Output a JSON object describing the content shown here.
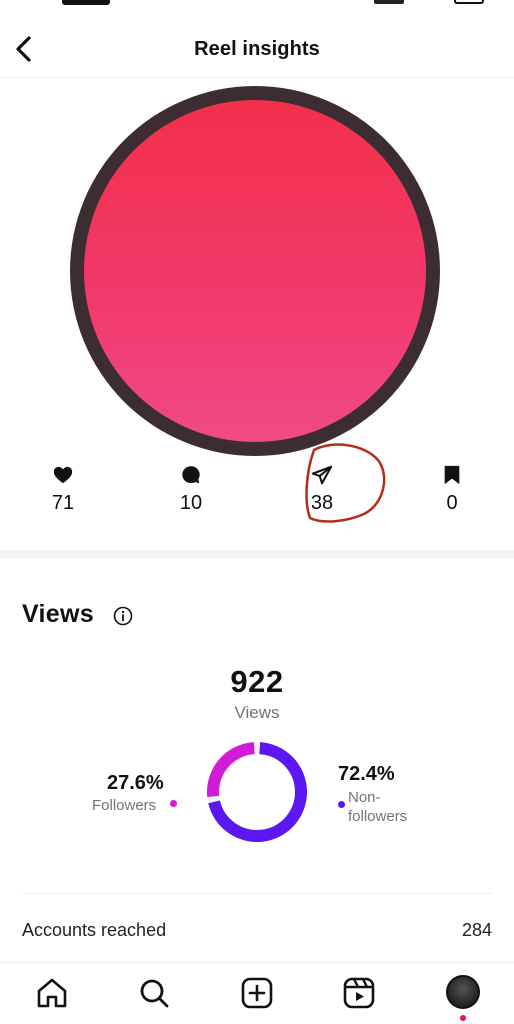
{
  "header": {
    "title": "Reel insights"
  },
  "stats": {
    "likes": "71",
    "comments": "10",
    "shares": "38",
    "saves": "0"
  },
  "views": {
    "section_title": "Views",
    "total": "922",
    "total_label": "Views",
    "followers_pct": "27.6%",
    "followers_label": "Followers",
    "nonfollowers_pct": "72.4%",
    "nonfollowers_label": "Non-followers",
    "followers_fraction": 0.276,
    "colors": {
      "followers": "#d21bd6",
      "nonfollowers": "#5b18f2"
    }
  },
  "accounts_reached": {
    "label": "Accounts reached",
    "value": "284"
  },
  "thumbnail": {
    "colors": [
      "#f3304a",
      "#f04a86"
    ],
    "ring_color": "#3b2d31"
  },
  "annotation": {
    "color": "#b32d17"
  },
  "tabbar": {
    "icons": [
      "home-icon",
      "search-icon",
      "create-icon",
      "reels-icon",
      "profile-avatar"
    ]
  }
}
